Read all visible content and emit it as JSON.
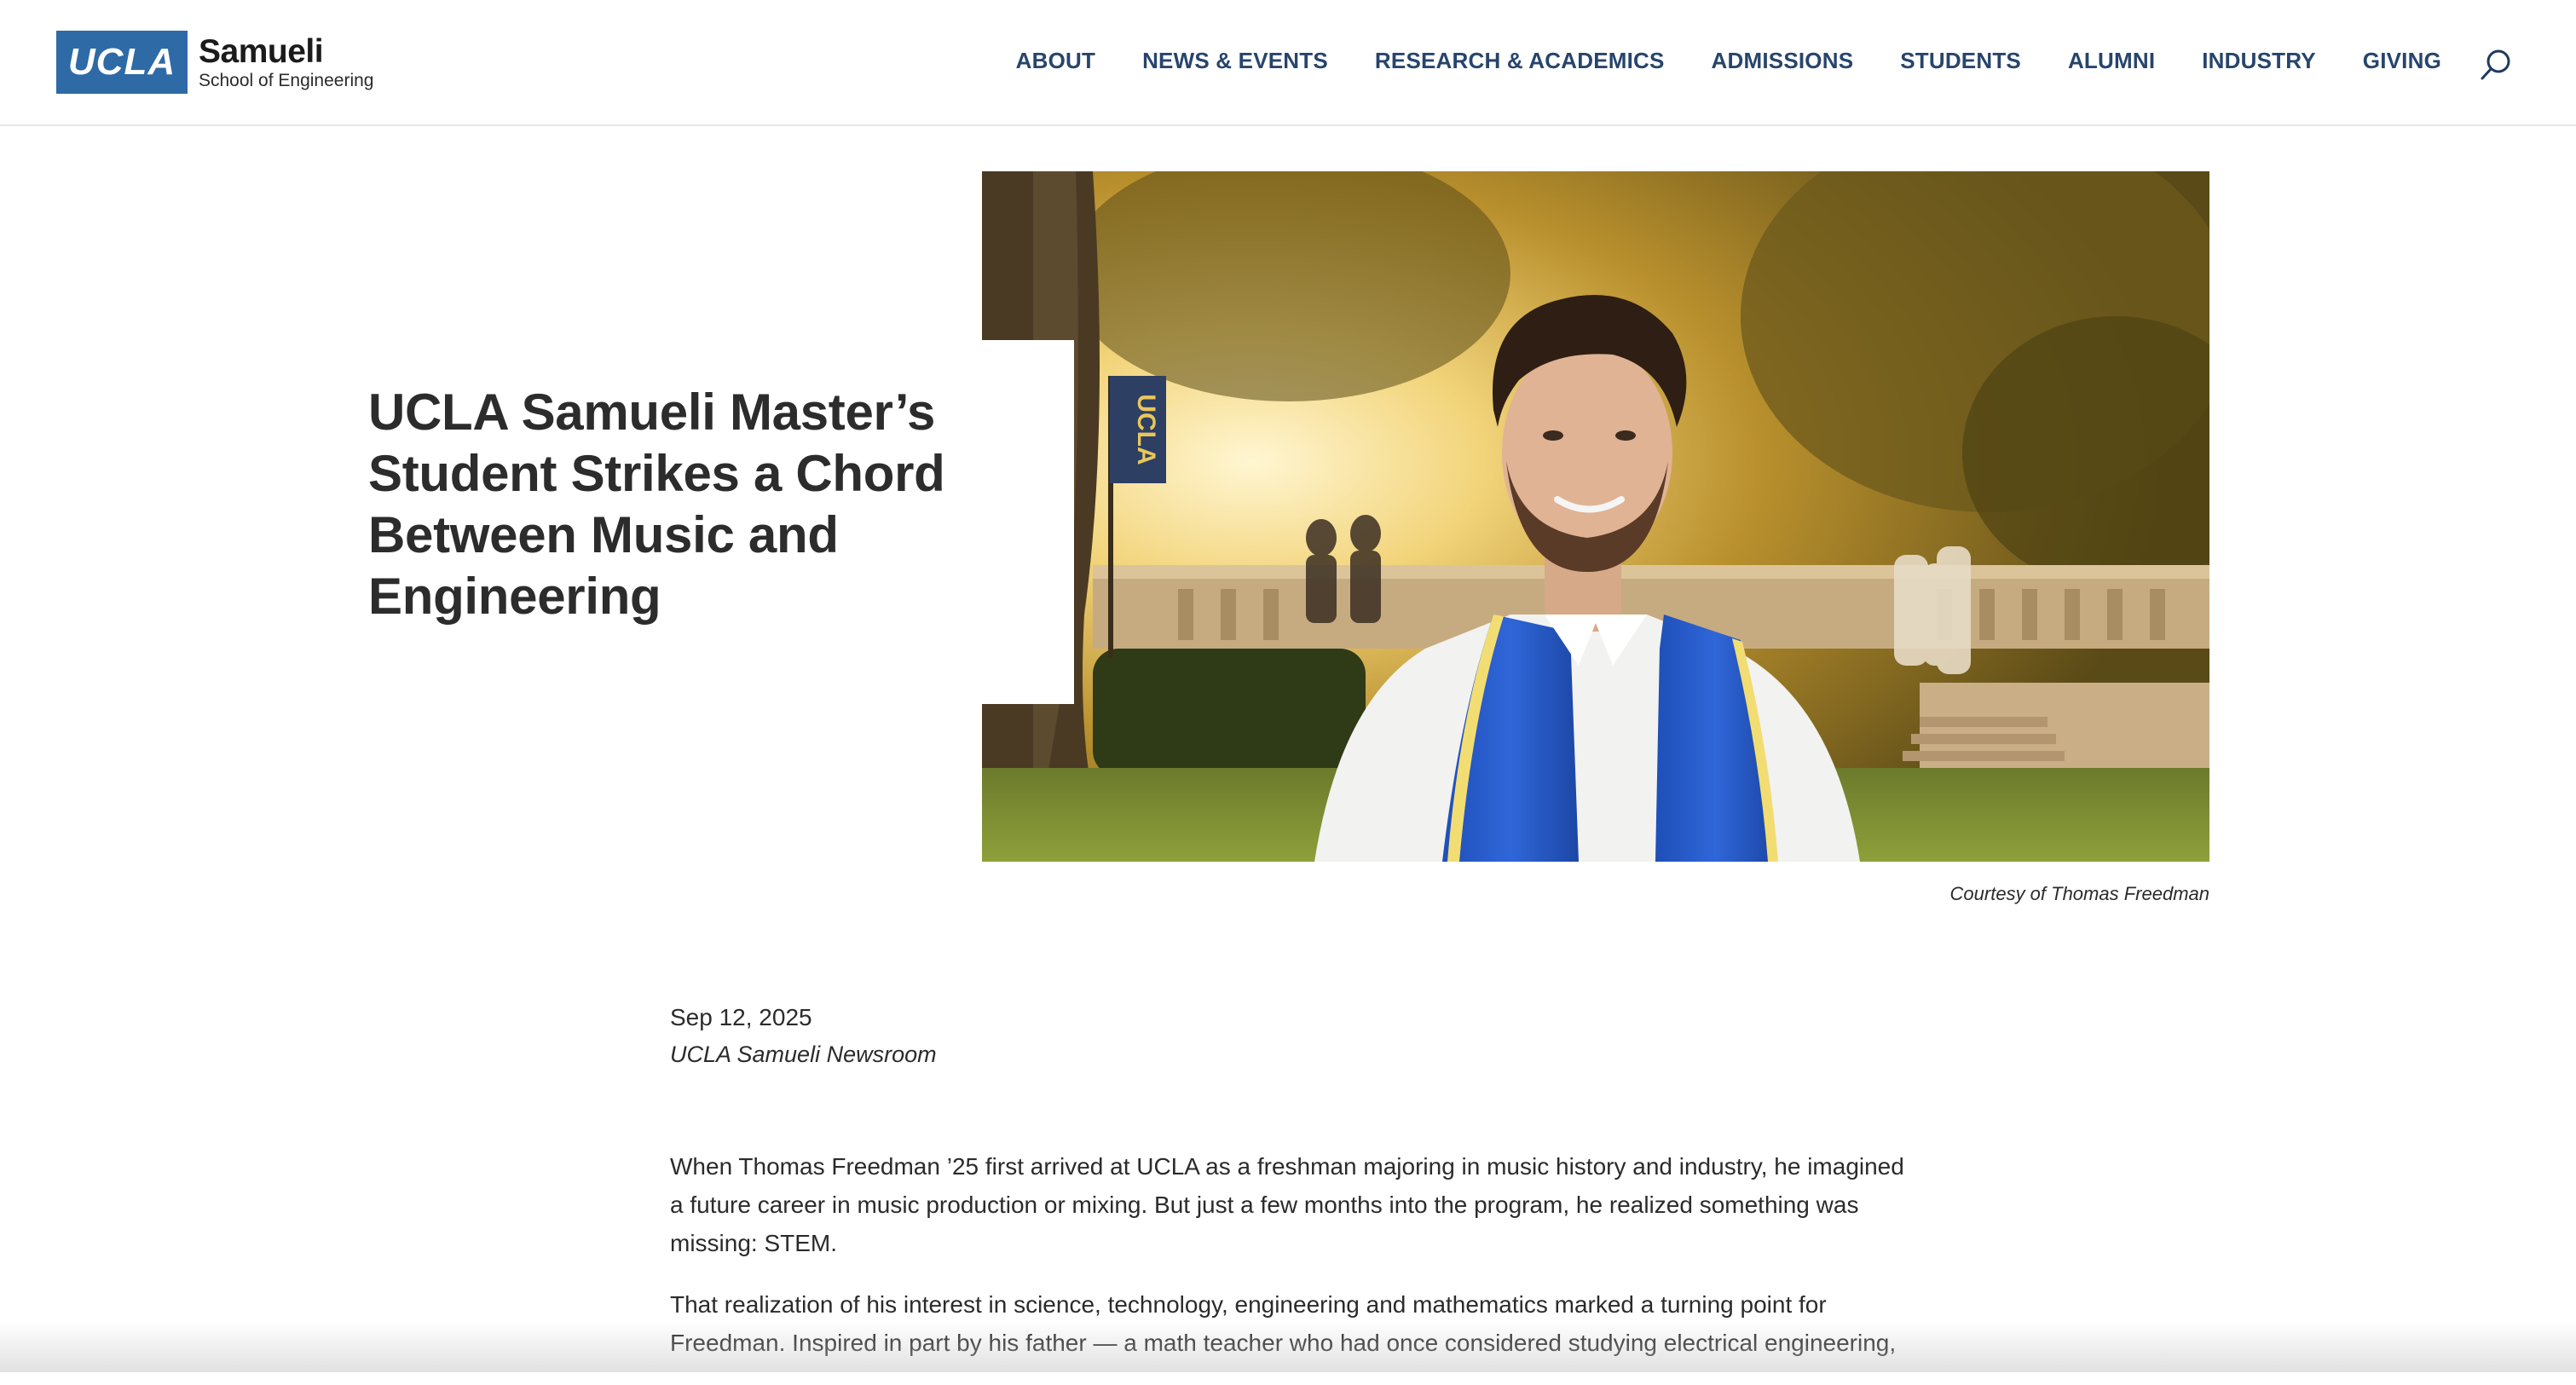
{
  "header": {
    "logo": {
      "mark": "UCLA",
      "name": "Samueli",
      "subtitle": "School of Engineering"
    },
    "nav": [
      {
        "label": "ABOUT"
      },
      {
        "label": "NEWS & EVENTS"
      },
      {
        "label": "RESEARCH & ACADEMICS"
      },
      {
        "label": "ADMISSIONS"
      },
      {
        "label": "STUDENTS"
      },
      {
        "label": "ALUMNI"
      },
      {
        "label": "INDUSTRY"
      },
      {
        "label": "GIVING"
      }
    ],
    "search_icon": "search-icon"
  },
  "hero": {
    "headline": "UCLA Samueli Master’s Student Strikes a Chord Between Music and Engineering",
    "photo_banner_text": "UCLA",
    "caption": "Courtesy of Thomas Freedman"
  },
  "article": {
    "date": "Sep 12, 2025",
    "source": "UCLA Samueli Newsroom",
    "paragraphs": [
      "When Thomas Freedman ’25 first arrived at UCLA as a freshman majoring in music history and industry, he imagined a future career in music production or mixing. But just a few months into the program, he realized something was missing: STEM.",
      "That realization of his interest in science, technology, engineering and mathematics marked a turning point for Freedman. Inspired in part by his father — a math teacher who had once considered studying electrical engineering,"
    ]
  },
  "colors": {
    "brand_blue": "#2d6aa6",
    "nav_text": "#27456c",
    "body_text": "#2b2b2b"
  }
}
